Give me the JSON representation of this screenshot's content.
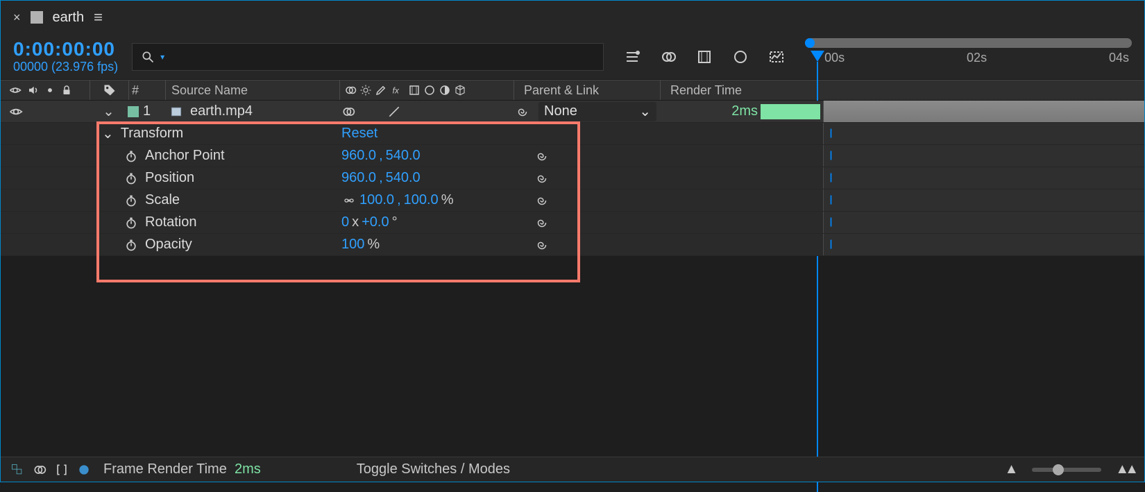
{
  "tab": {
    "close": "×",
    "name": "earth",
    "menu": "≡"
  },
  "header": {
    "timecode": "0:00:00:00",
    "frameinfo": "00000 (23.976 fps)",
    "ruler": [
      "00s",
      "02s",
      "04s"
    ]
  },
  "columns": {
    "num": "#",
    "source": "Source Name",
    "parent": "Parent & Link",
    "render": "Render Time"
  },
  "layer": {
    "index": "1",
    "name": "earth.mp4",
    "parent": "None",
    "render": "2ms"
  },
  "transform": {
    "title": "Transform",
    "reset": "Reset",
    "props": {
      "anchor": {
        "label": "Anchor Point",
        "v1": "960.0",
        "v2": "540.0"
      },
      "position": {
        "label": "Position",
        "v1": "960.0",
        "v2": "540.0"
      },
      "scale": {
        "label": "Scale",
        "v1": "100.0",
        "v2": "100.0",
        "unit": "%"
      },
      "rotation": {
        "label": "Rotation",
        "turns": "0",
        "deg": "+0.0",
        "unit": "°"
      },
      "opacity": {
        "label": "Opacity",
        "v": "100",
        "unit": "%"
      }
    }
  },
  "status": {
    "frt_label": "Frame Render Time",
    "frt_value": "2ms",
    "toggle": "Toggle Switches / Modes"
  }
}
